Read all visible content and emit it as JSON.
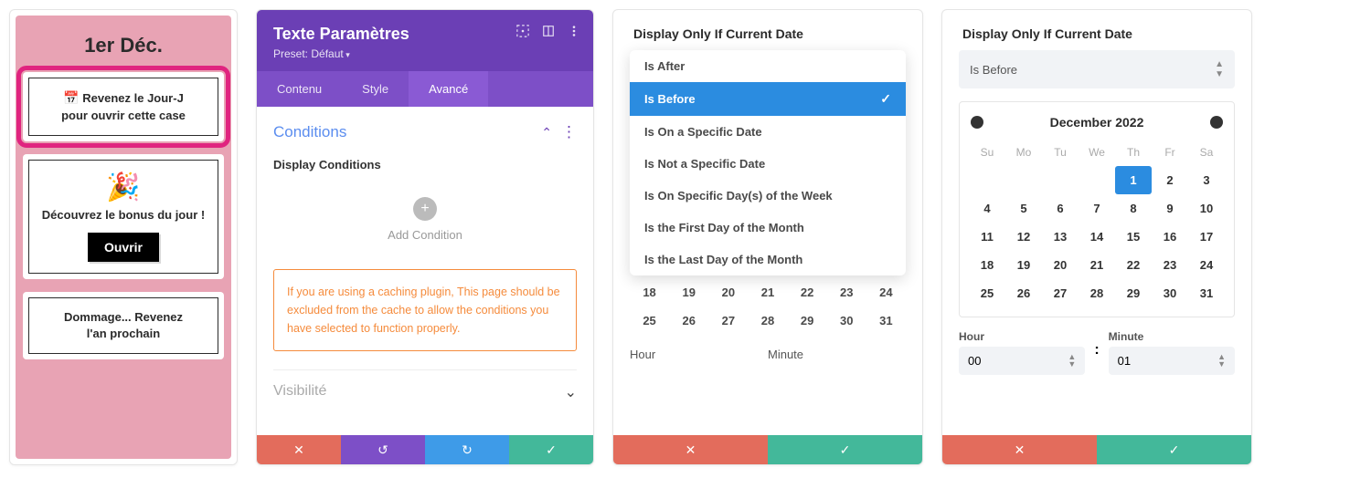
{
  "panel1": {
    "title": "1er Déc.",
    "card1_line1": "Revenez le Jour-J",
    "card1_line2": "pour ouvrir cette case",
    "card2_head": "Découvrez le bonus du jour !",
    "card2_btn": "Ouvrir",
    "card3_line1": "Dommage... Revenez",
    "card3_line2": "l'an prochain"
  },
  "panel2": {
    "title": "Texte Paramètres",
    "preset": "Preset: Défaut",
    "tabs": {
      "contenu": "Contenu",
      "style": "Style",
      "avance": "Avancé"
    },
    "section": "Conditions",
    "display_conditions": "Display Conditions",
    "add_condition": "Add Condition",
    "warning": "If you are using a caching plugin, This page should be excluded from the cache to allow the conditions you have selected to function properly.",
    "visibility": "Visibilité"
  },
  "panel3": {
    "heading": "Display Only If Current Date",
    "options": {
      "is_after": "Is After",
      "is_before": "Is Before",
      "is_on_specific": "Is On a Specific Date",
      "is_not_specific": "Is Not a Specific Date",
      "is_on_days": "Is On Specific Day(s) of the Week",
      "is_first": "Is the First Day of the Month",
      "is_last": "Is the Last Day of the Month"
    },
    "cal_rows": [
      [
        "18",
        "19",
        "20",
        "21",
        "22",
        "23",
        "24"
      ],
      [
        "25",
        "26",
        "27",
        "28",
        "29",
        "30",
        "31"
      ]
    ],
    "hour": "Hour",
    "minute": "Minute"
  },
  "panel4": {
    "heading": "Display Only If Current Date",
    "selected": "Is Before",
    "month": "December 2022",
    "dow": [
      "Su",
      "Mo",
      "Tu",
      "We",
      "Th",
      "Fr",
      "Sa"
    ],
    "rows": [
      [
        "",
        "",
        "",
        "",
        "1",
        "2",
        "3"
      ],
      [
        "4",
        "5",
        "6",
        "7",
        "8",
        "9",
        "10"
      ],
      [
        "11",
        "12",
        "13",
        "14",
        "15",
        "16",
        "17"
      ],
      [
        "18",
        "19",
        "20",
        "21",
        "22",
        "23",
        "24"
      ],
      [
        "25",
        "26",
        "27",
        "28",
        "29",
        "30",
        "31"
      ]
    ],
    "selected_day": "1",
    "hour_label": "Hour",
    "minute_label": "Minute",
    "hour_val": "00",
    "minute_val": "01"
  }
}
